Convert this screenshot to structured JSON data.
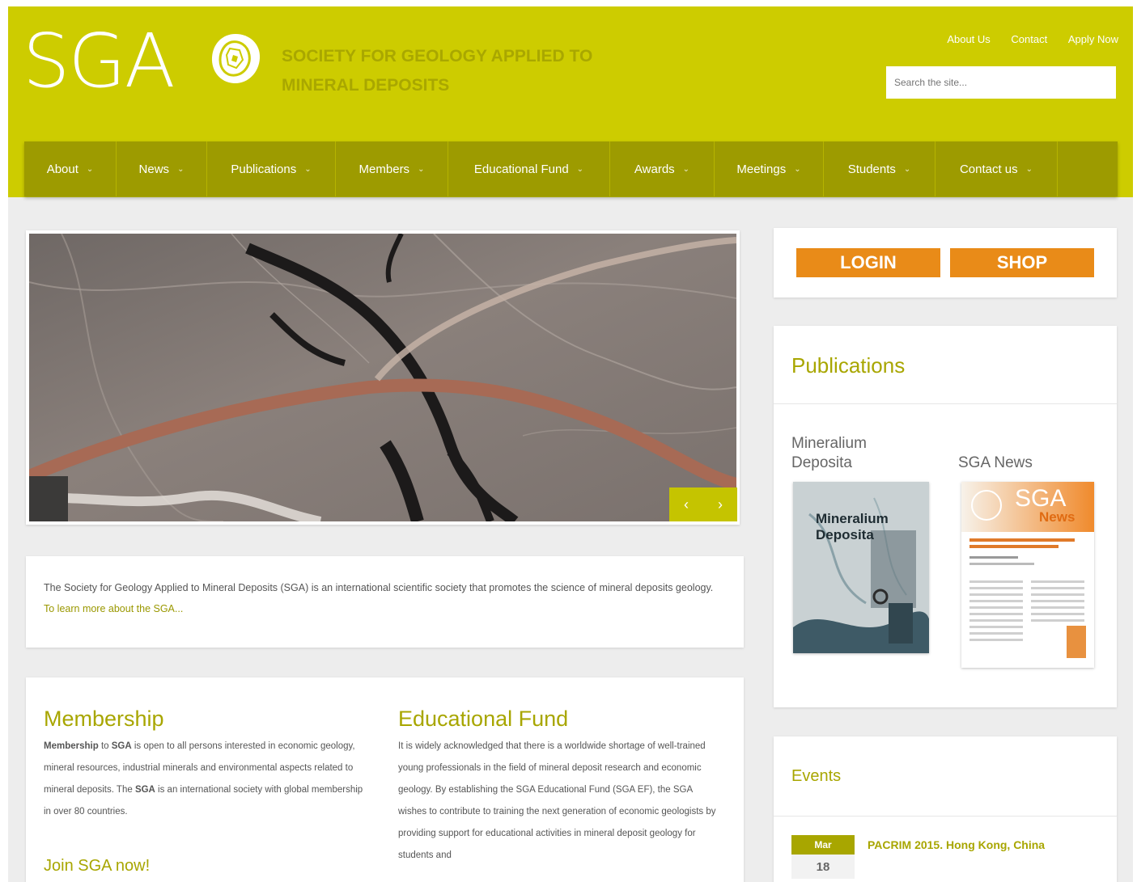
{
  "header": {
    "logo_text": "SGA",
    "society_name": "SOCIETY FOR GEOLOGY APPLIED TO MINERAL DEPOSITS",
    "top_links": [
      "About Us",
      "Contact",
      "Apply Now"
    ],
    "search_placeholder": "Search the site..."
  },
  "nav": {
    "items": [
      "About",
      "News",
      "Publications",
      "Members",
      "Educational Fund",
      "Awards",
      "Meetings",
      "Students",
      "Contact us"
    ],
    "chevron": "⌄"
  },
  "slider": {
    "prev_label": "‹",
    "next_label": "›"
  },
  "intro": {
    "text": "The Society for Geology Applied to Mineral Deposits (SGA) is an international scientific society that promotes the science of mineral deposits geology. ",
    "link": "To learn more about the SGA..."
  },
  "membership": {
    "title": "Membership",
    "bold1": "Membership",
    "t1": " to ",
    "bold2": "SGA",
    "t2": " is open to all persons interested in economic geology, mineral resources, industrial minerals and environmental aspects related to mineral deposits. The ",
    "bold3": "SGA",
    "t3": " is an international society with global membership in over 80 countries.",
    "join": "Join SGA now!"
  },
  "educational_fund": {
    "title": "Educational Fund",
    "text": "It is widely acknowledged that there is a worldwide shortage of well-trained young professionals in the field of mineral deposit research and economic geology. By establishing the SGA Educational Fund (SGA EF), the SGA wishes to contribute to training the next generation of economic geologists by providing support for educational activities in mineral deposit geology for students and"
  },
  "sidebar": {
    "login_label": "LOGIN",
    "shop_label": "SHOP",
    "publications_title": "Publications",
    "pub1_name": "Mineralium Deposita",
    "pub1_cover_text": "Mineralium Deposita",
    "pub2_name": "SGA News",
    "pub2_cover_text": "SGA",
    "pub2_cover_sub": "News",
    "events_title": "Events",
    "event": {
      "month": "Mar",
      "day": "18",
      "title": "PACRIM 2015. Hong Kong, China"
    }
  },
  "colors": {
    "brand": "#cdcc00",
    "nav": "#9d9b00",
    "accent_text": "#a8a600",
    "button": "#e98b18"
  }
}
